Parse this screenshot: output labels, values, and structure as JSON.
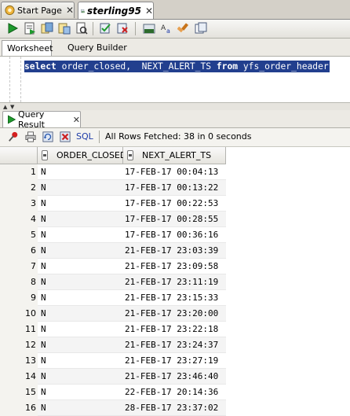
{
  "tabs": [
    {
      "label": "Start Page",
      "active": false
    },
    {
      "label": "sterling95",
      "active": true
    }
  ],
  "worksheet_tabs": [
    "Worksheet",
    "Query Builder"
  ],
  "editor": {
    "sql_parts": [
      {
        "text": "select",
        "keyword": true
      },
      {
        "text": " order_closed,  NEXT_ALERT_TS ",
        "keyword": false
      },
      {
        "text": "from",
        "keyword": true
      },
      {
        "text": " yfs_order_header",
        "keyword": false
      }
    ]
  },
  "results": {
    "tab_label": "Query Result",
    "sql_link": "SQL",
    "status": "All Rows Fetched: 38 in 0 seconds",
    "columns": [
      "ORDER_CLOSED",
      "NEXT_ALERT_TS"
    ],
    "rows": [
      {
        "n": "1",
        "closed": "N",
        "ts": "17-FEB-17 00:04:13"
      },
      {
        "n": "2",
        "closed": "N",
        "ts": "17-FEB-17 00:13:22"
      },
      {
        "n": "3",
        "closed": "N",
        "ts": "17-FEB-17 00:22:53"
      },
      {
        "n": "4",
        "closed": "N",
        "ts": "17-FEB-17 00:28:55"
      },
      {
        "n": "5",
        "closed": "N",
        "ts": "17-FEB-17 00:36:16"
      },
      {
        "n": "6",
        "closed": "N",
        "ts": "21-FEB-17 23:03:39"
      },
      {
        "n": "7",
        "closed": "N",
        "ts": "21-FEB-17 23:09:58"
      },
      {
        "n": "8",
        "closed": "N",
        "ts": "21-FEB-17 23:11:19"
      },
      {
        "n": "9",
        "closed": "N",
        "ts": "21-FEB-17 23:15:33"
      },
      {
        "n": "10",
        "closed": "N",
        "ts": "21-FEB-17 23:20:00"
      },
      {
        "n": "11",
        "closed": "N",
        "ts": "21-FEB-17 23:22:18"
      },
      {
        "n": "12",
        "closed": "N",
        "ts": "21-FEB-17 23:24:37"
      },
      {
        "n": "13",
        "closed": "N",
        "ts": "21-FEB-17 23:27:19"
      },
      {
        "n": "14",
        "closed": "N",
        "ts": "21-FEB-17 23:46:40"
      },
      {
        "n": "15",
        "closed": "N",
        "ts": "22-FEB-17 20:14:36"
      },
      {
        "n": "16",
        "closed": "N",
        "ts": "28-FEB-17 23:37:02"
      }
    ]
  },
  "icons": {
    "toolbar": [
      "run-statement-icon",
      "run-script-icon",
      "autotrace-icon",
      "explain-plan-icon",
      "sql-tuning-icon",
      "commit-icon",
      "rollback-icon",
      "unshared-sql-icon",
      "to-upper-lower-icon",
      "clear-icon",
      "sql-history-icon"
    ],
    "result_toolbar": [
      "pin-icon",
      "print-icon",
      "refresh-icon",
      "delete-icon"
    ]
  },
  "colors": {
    "selection": "#223f8e",
    "run_green": "#1f9a2e",
    "sql_link": "#1c3aa8"
  }
}
